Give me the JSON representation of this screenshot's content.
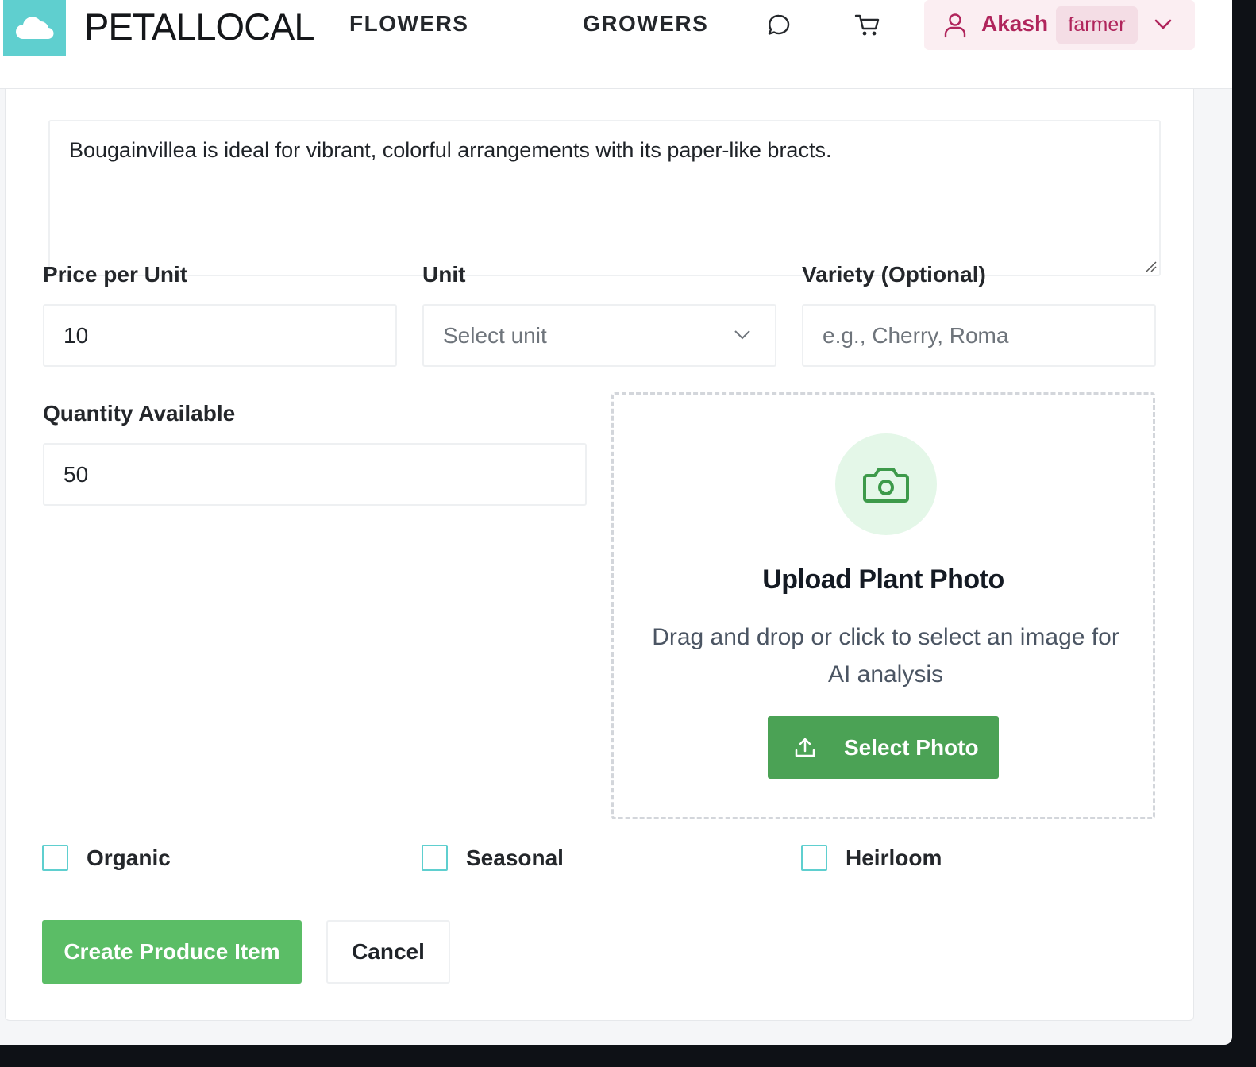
{
  "header": {
    "brand": "PETALLOCAL",
    "nav": [
      {
        "label": "FLOWERS"
      },
      {
        "label": "GROWERS"
      }
    ],
    "user": {
      "name": "Akash",
      "role": "farmer"
    }
  },
  "form": {
    "description_value": "Bougainvillea is ideal for vibrant, colorful arrangements with its paper-like bracts.",
    "price": {
      "label": "Price per Unit",
      "value": "10"
    },
    "unit": {
      "label": "Unit",
      "placeholder": "Select unit"
    },
    "variety": {
      "label": "Variety (Optional)",
      "placeholder": "e.g., Cherry, Roma"
    },
    "quantity": {
      "label": "Quantity Available",
      "value": "50"
    },
    "upload": {
      "title": "Upload Plant Photo",
      "description": "Drag and drop or click to select an image for AI analysis",
      "button": "Select Photo"
    },
    "checkboxes": [
      {
        "label": "Organic",
        "checked": false
      },
      {
        "label": "Seasonal",
        "checked": false
      },
      {
        "label": "Heirloom",
        "checked": false
      }
    ],
    "actions": {
      "submit": "Create Produce Item",
      "cancel": "Cancel"
    }
  },
  "colors": {
    "accent_teal": "#5fcfcf",
    "primary_green": "#5bbd66",
    "upload_green": "#4ba255",
    "user_pink": "#b0255c"
  }
}
